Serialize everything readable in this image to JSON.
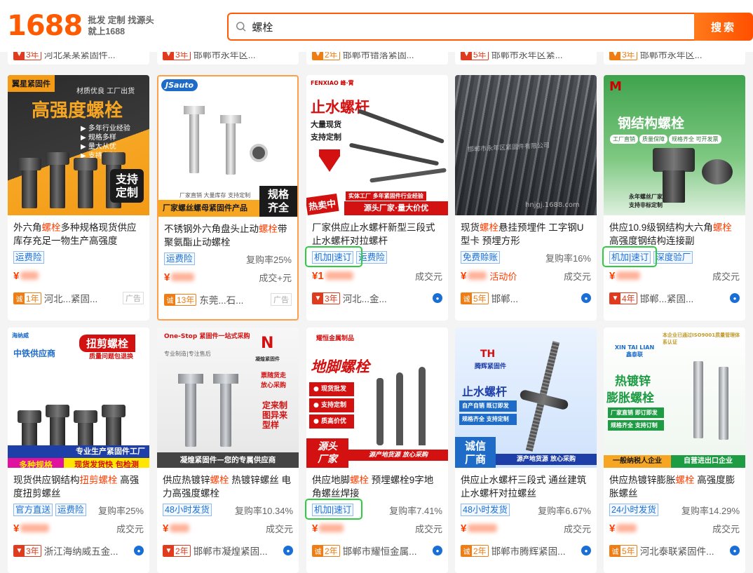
{
  "header": {
    "logo_text": "1688",
    "logo_sub_line1": "批发 定制 找源头",
    "logo_sub_line2": "就上1688",
    "search_value": "螺栓",
    "search_button": "搜索"
  },
  "colors": {
    "brand": "#ff5a00",
    "accent_red": "#ff3d00",
    "tag_blue": "#1a6fd6",
    "highlight_green": "#2ecc40"
  },
  "prev_row": [
    {
      "badge": "3年",
      "text": "河北某某紧固件..."
    },
    {
      "badge": "3年",
      "text": "邯郸市永年区..."
    },
    {
      "badge": "2年",
      "text": "邯郸市错落紧固..."
    },
    {
      "badge": "5年",
      "text": "邯郸市永年区紧..."
    },
    {
      "badge": "3年",
      "text": "邯郸市永年区..."
    }
  ],
  "cards": [
    {
      "img": {
        "top_label": "翼星紧固件",
        "sub": "材质优良 工厂出货",
        "big": "高强度螺栓",
        "list": [
          "多年行业经验",
          "规格多样",
          "量大从优",
          "支持定制"
        ],
        "corner": "支持定制"
      },
      "title_a": "外六角",
      "title_em": "螺栓",
      "title_b": "多种规格现货供应库存充足一物生产高强度",
      "tags": [
        "运费险"
      ],
      "rate": "",
      "price": "¥",
      "deal": "",
      "shop_badge": "1年",
      "shop": "河北...紧固...",
      "ad": "广告"
    },
    {
      "img": {
        "logo": "JSauto",
        "footer": "厂家直销 大量库存 支持定制",
        "bottom": "厂家螺丝螺母紧固件产品",
        "corner": "规格齐全"
      },
      "title_a": "不锈钢外六角盘头止动",
      "title_em": "螺栓",
      "title_b": "带聚氨酯止动螺栓",
      "tags": [
        "运费险"
      ],
      "rate": "复购率25%",
      "price": "¥",
      "deal": "成交+元",
      "shop_badge": "13年",
      "shop": "东莞...石...",
      "ad": "广告"
    },
    {
      "img": {
        "brand": "FENXIAO 峰·霄",
        "big": "止水螺杆",
        "sub1": "大量现货",
        "sub2": "支持定制",
        "banner": "实体工厂 多年紧固件行业经验",
        "hot": "热卖中",
        "bottom": "源头厂家·量大价优"
      },
      "title_a": "厂家供应止水螺杆",
      "title_em": "",
      "title_b": "新型三段式止水螺杆对拉螺杆",
      "tags": [
        "机加|速订",
        "运费险"
      ],
      "rate": "",
      "price": "¥1",
      "deal": "成交元",
      "shop_badge": "3年",
      "shop": "河北...金...",
      "ad": ""
    },
    {
      "img": {
        "watermark": "邯郸市永年区紧固件有限公司",
        "site": "hnjgj.1688.com"
      },
      "title_a": "现货",
      "title_em": "螺栓",
      "title_b": "悬挂预埋件 工字钢U型卡 预埋方形",
      "tags": [
        "免费赊账"
      ],
      "rate": "复购率16%",
      "price": "¥",
      "deal": "成交元",
      "activity": "活动价",
      "shop_badge": "5年",
      "shop": "邯郸...",
      "ad": ""
    },
    {
      "img": {
        "big": "钢结构螺栓",
        "chips": [
          "工厂直销",
          "质量保障",
          "规格齐全 可开发票"
        ],
        "footer1": "永年螺丝厂家",
        "footer2": "支持非标定制"
      },
      "title_a": "供应10.9级钢结构大六角",
      "title_em": "螺栓",
      "title_b": " 高强度钢结构连接副",
      "tags": [
        "机加|速订",
        "深度验厂"
      ],
      "rate": "",
      "price": "¥",
      "deal": "成交元",
      "shop_badge": "4年",
      "shop": "邯郸...紧固...",
      "ad": ""
    },
    {
      "img": {
        "corner_brand": "海纳威",
        "ribbon": "扭剪螺栓",
        "ribbon_sub": "质量问题包退换",
        "badge": "中铁供应商",
        "strip1": "专业生产紧固件工厂",
        "strip2": "多种规格",
        "strip3": "现货发货快 包检测"
      },
      "title_a": "现货供应钢结构",
      "title_em": "扭剪螺栓",
      "title_b": " 高强度扭剪螺丝",
      "tags": [
        "官方直送",
        "运费险"
      ],
      "rate": "复购率25%",
      "price": "¥",
      "deal": "成交元",
      "shop_badge": "3年",
      "shop": "浙江海纳威五金...",
      "ad": ""
    },
    {
      "img": {
        "brand": "One-Stop 紧固件一站式采购",
        "sub": "专业制造|专注售后",
        "logo": "凝煌紧固件",
        "side": [
          "票随货走",
          "放心采购"
        ],
        "vert": "定来制图异来型样",
        "footer": "凝煌紧固件—您的专属供应商"
      },
      "title_a": "供应热镀锌",
      "title_em": "螺栓",
      "title_b": " 热镀锌螺丝 电力高强度螺栓",
      "tags": [
        "48小时发货"
      ],
      "rate": "复购率10.34%",
      "price": "¥",
      "deal": "成交元",
      "shop_badge": "2年",
      "shop": "邯郸市凝煌紧固...",
      "ad": ""
    },
    {
      "img": {
        "brand": "耀恒金属制品",
        "big": "地脚螺栓",
        "chips": [
          "现货批发",
          "支持定制",
          "质高价优"
        ],
        "footer_l": "源头厂家",
        "footer_r": "源产地货源 放心采购"
      },
      "title_a": "供应地脚",
      "title_em": "螺栓",
      "title_b": " 预埋螺栓9字地角螺丝焊接",
      "tags": [
        "机加|速订"
      ],
      "rate": "复购率7.41%",
      "price": "¥",
      "deal": "成交元",
      "shop_badge": "2年",
      "shop": "邯郸市耀恒金属...",
      "ad": ""
    },
    {
      "img": {
        "brand": "腾辉紧固件",
        "big": "止水螺杆",
        "chips": [
          "自产自销 既订即发",
          "规格齐全 支持定制"
        ],
        "footer_l": "诚信厂商",
        "footer_r": "源产地货源 放心采购"
      },
      "title_a": "供应止水螺杆三段式 通丝",
      "title_em": "",
      "title_b": "建筑止水螺杆对拉螺丝",
      "tags": [
        "48小时发货"
      ],
      "rate": "复购率6.67%",
      "price": "¥",
      "deal": "成交元",
      "shop_badge": "2年",
      "shop": "邯郸市腾辉紧固...",
      "ad": ""
    },
    {
      "img": {
        "iso": "本企业已通过ISO9001质量管理体系认证",
        "brand": "XIN TAI LIAN 鑫泰联",
        "big1": "热镀锌",
        "big2": "膨胀螺栓",
        "chips": [
          "厂家直销 即订即发",
          "规格齐全 支持订制"
        ],
        "footer_l": "一般纳税人企业",
        "footer_r": "自营进出口企业"
      },
      "title_a": "供应热镀锌膨胀",
      "title_em": "螺栓",
      "title_b": " 高强度膨胀螺丝",
      "tags": [
        "24小时发货"
      ],
      "rate": "复购率14.29%",
      "price": "¥",
      "deal": "成交元",
      "shop_badge": "5年",
      "shop": "河北泰联紧固件...",
      "ad": ""
    }
  ]
}
